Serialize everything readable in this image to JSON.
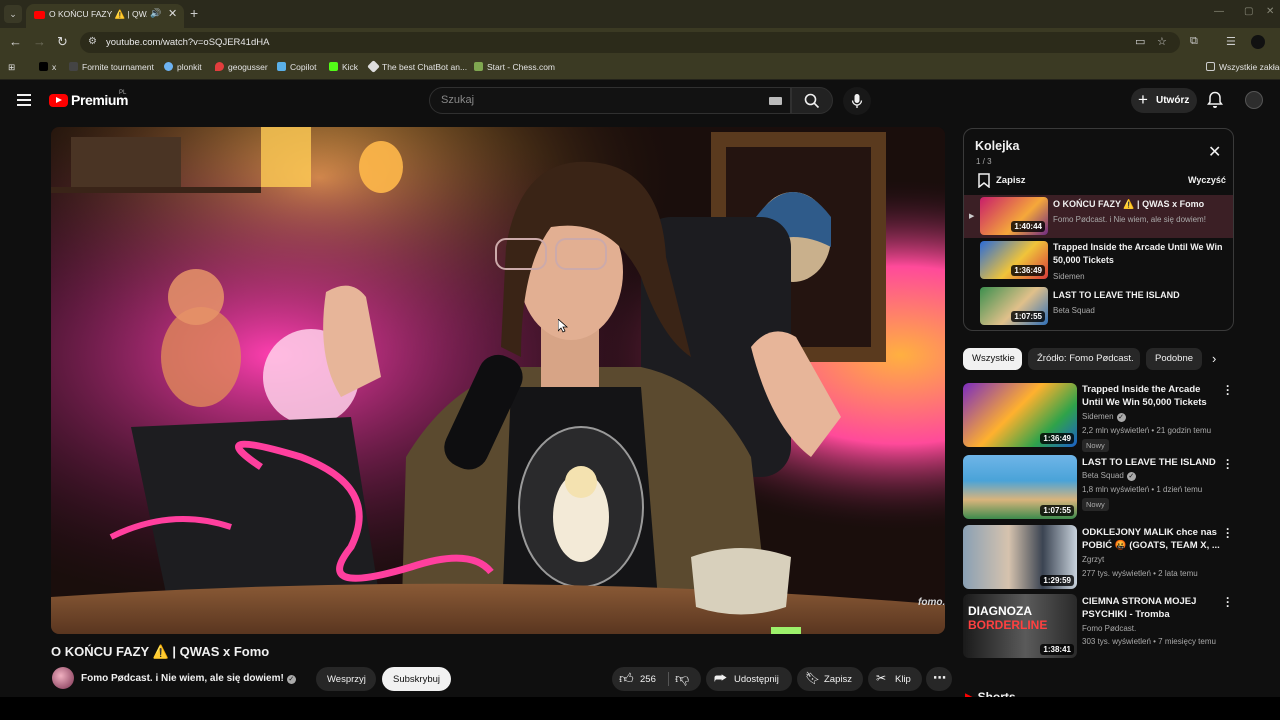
{
  "browser": {
    "tab_title": "O KOŃCU FAZY ⚠️ | QWAS",
    "url": "youtube.com/watch?v=oSQJER41dHA",
    "bookmarks": [
      {
        "label": "x",
        "color": "#000000"
      },
      {
        "label": "Fornite tournament",
        "color": "#222222"
      },
      {
        "label": "plonkit",
        "color": "#6db3f2"
      },
      {
        "label": "geogusser",
        "color": "#e23d3d"
      },
      {
        "label": "Copilot",
        "color": "#5ab0e8"
      },
      {
        "label": "Kick",
        "color": "#53fc18"
      },
      {
        "label": "The best ChatBot an...",
        "color": "#dddddd"
      },
      {
        "label": "Start - Chess.com",
        "color": "#7fa650"
      }
    ],
    "all_bookmarks": "Wszystkie zakładki"
  },
  "header": {
    "logo": "Premium",
    "country": "PL",
    "search_placeholder": "Szukaj",
    "create_label": "Utwórz"
  },
  "video": {
    "title": "O KOŃCU FAZY ⚠️ | QWAS x Fomo",
    "watermark": "fomo.",
    "channel": "Fomo Pødcast. i Nie wiem, ale się dowiem!",
    "support_label": "Wesprzyj",
    "subscribe_label": "Subskrybuj",
    "likes": "256",
    "share_label": "Udostępnij",
    "save_label": "Zapisz",
    "clip_label": "Klip"
  },
  "queue": {
    "title": "Kolejka",
    "count": "1 / 3",
    "save_label": "Zapisz",
    "clear_label": "Wyczyść",
    "items": [
      {
        "title": "O KOŃCU FAZY ⚠️ | QWAS x Fomo",
        "channel": "Fomo Pødcast. i Nie wiem, ale się dowiem!",
        "duration": "1:40:44"
      },
      {
        "title": "Trapped Inside the Arcade Until We Win 50,000 Tickets",
        "channel": "Sidemen",
        "duration": "1:36:49"
      },
      {
        "title": "LAST TO LEAVE THE ISLAND",
        "channel": "Beta Squad",
        "duration": "1:07:55"
      }
    ]
  },
  "chips": [
    "Wszystkie",
    "Źródło: Fomo Pødcast.",
    "Podobne"
  ],
  "recommendations": [
    {
      "title": "Trapped Inside the Arcade Until We Win 50,000 Tickets",
      "channel": "Sidemen",
      "meta": "2,2 mln wyświetleń • 21 godzin temu",
      "badge": "Nowy",
      "duration": "1:36:49"
    },
    {
      "title": "LAST TO LEAVE THE ISLAND",
      "channel": "Beta Squad",
      "meta": "1,8 mln wyświetleń • 1 dzień temu",
      "badge": "Nowy",
      "duration": "1:07:55"
    },
    {
      "title": "ODKLEJONY MALIK chce nas POBIĆ 🤬 (GOATS, TEAM X, ...",
      "channel": "Zgrzyt",
      "meta": "277 tys. wyświetleń • 2 lata temu",
      "badge": "",
      "duration": "1:29:59"
    },
    {
      "title": "CIEMNA STRONA MOJEJ PSYCHIKI - Tromba",
      "channel": "Fomo Pødcast.",
      "meta": "303 tys. wyświetleń • 7 miesięcy temu",
      "badge": "",
      "duration": "1:38:41",
      "thumb_text": [
        "DIAGNOZA",
        "BORDERLINE"
      ]
    }
  ],
  "shorts_label": "Shorts"
}
